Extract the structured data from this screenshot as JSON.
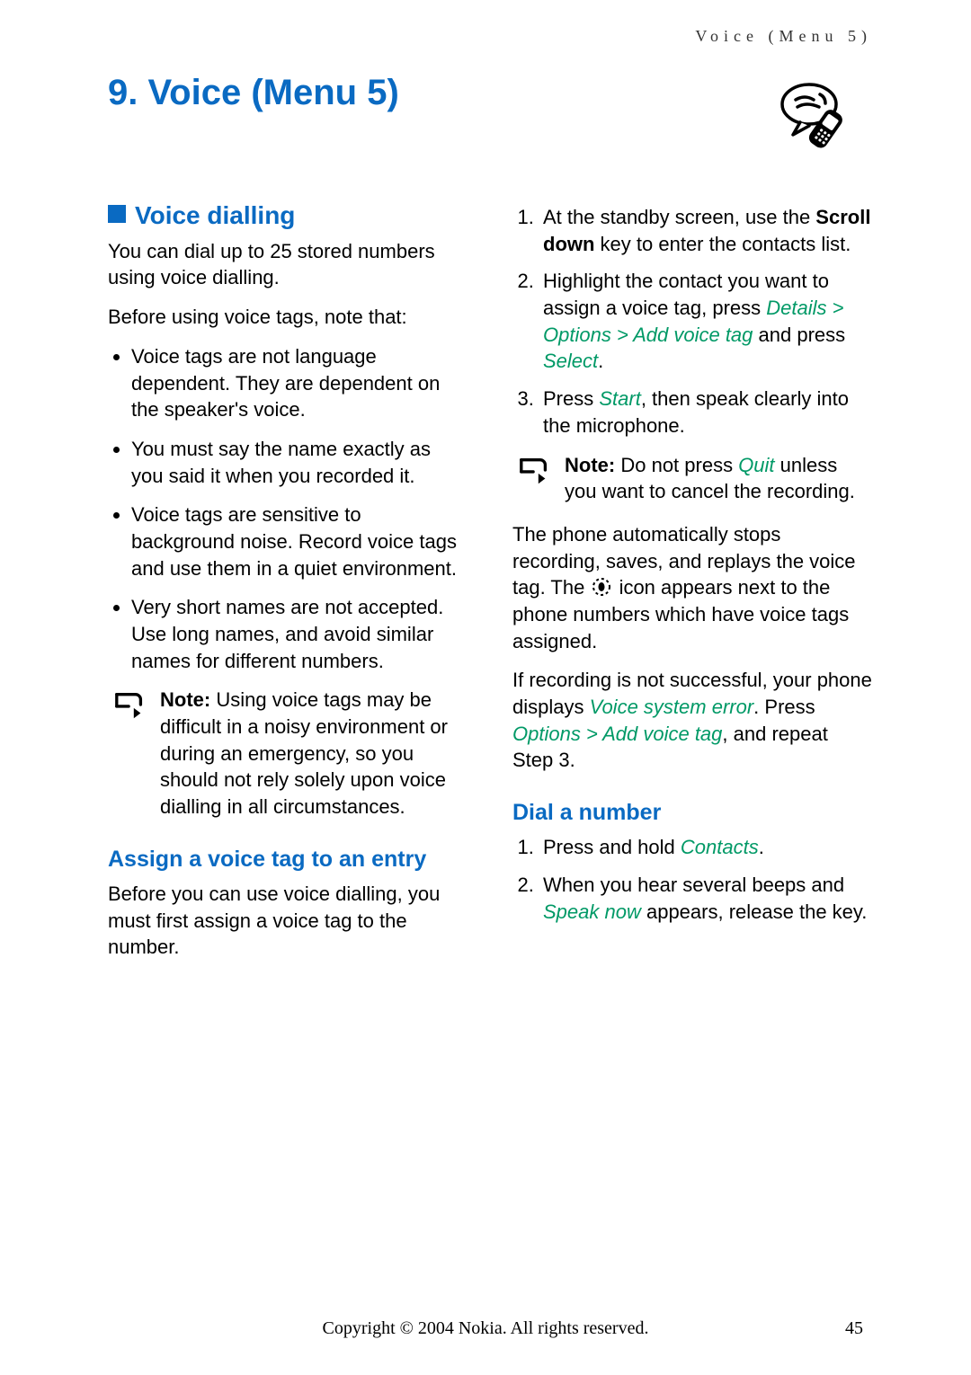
{
  "running_head": "Voice (Menu 5)",
  "chapter_title": "9.   Voice (Menu 5)",
  "section_voice_dialling": "Voice dialling",
  "vd_intro": "You can dial up to 25 stored numbers using voice dialling.",
  "vd_before": "Before using voice tags, note that:",
  "vd_bullets": [
    "Voice tags are not language dependent. They are dependent on the speaker's voice.",
    "You must say the name exactly as you said it when you recorded it.",
    "Voice tags are sensitive to background noise. Record voice tags and use them in a quiet environment.",
    "Very short names are not accepted. Use long names, and avoid similar names for different numbers."
  ],
  "note_label": "Note:",
  "vd_note": "Using voice tags may be difficult in a noisy environment or during an emergency, so you should not rely solely upon voice dialling in all circumstances.",
  "sub_assign": "Assign a voice tag to an entry",
  "assign_intro": "Before you can use voice dialling, you must first assign a voice tag to the number.",
  "assign_step1_a": "At the standby screen, use the ",
  "scroll_down": "Scroll down",
  "assign_step1_b": " key to enter the contacts list.",
  "assign_step2_a": "Highlight the contact you want to assign a voice tag, press ",
  "path_details": "Details",
  "gt": " > ",
  "path_options": "Options",
  "path_addtag": "Add voice tag",
  "assign_step2_b": " and press ",
  "select": "Select",
  "assign_step3_a": "Press ",
  "start": "Start",
  "assign_step3_b": ", then speak clearly into the microphone.",
  "quit_note_a": "Do not press ",
  "quit": "Quit",
  "quit_note_b": " unless you want to cancel the recording.",
  "after1_a": "The phone automatically stops recording, saves, and replays the voice tag. The ",
  "after1_b": " icon appears next to the phone numbers which have voice tags assigned.",
  "after2_a": "If recording is not successful, your phone displays ",
  "vse": "Voice system error",
  "after2_b": ". Press ",
  "after2_c": ", and repeat Step 3.",
  "sub_dial": "Dial a number",
  "dial_step1_a": "Press and hold ",
  "contacts": "Contacts",
  "dial_step2_a": "When you hear several beeps and ",
  "speak_now": "Speak now",
  "dial_step2_b": " appears, release the key.",
  "footer": "Copyright © 2004 Nokia. All rights reserved.",
  "page_number": "45"
}
